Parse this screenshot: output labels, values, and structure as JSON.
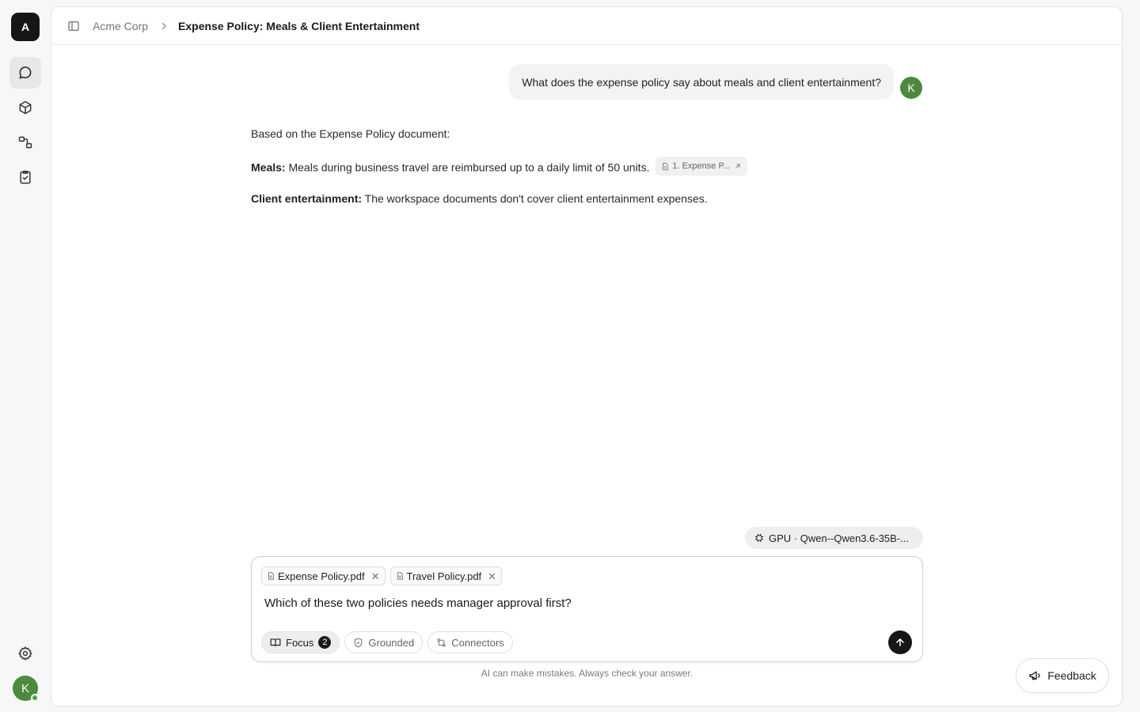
{
  "workspace": {
    "initial": "A",
    "name": "Acme Corp"
  },
  "rail": {
    "nav": [
      {
        "id": "chat",
        "icon": "chat-bubble-icon",
        "active": true
      },
      {
        "id": "knowledge",
        "icon": "cube-icon",
        "active": false
      },
      {
        "id": "workflows",
        "icon": "workflow-icon",
        "active": false
      },
      {
        "id": "tasks",
        "icon": "clipboard-check-icon",
        "active": false
      }
    ],
    "settings_icon": "gear-icon",
    "user_initial": "K"
  },
  "breadcrumb": {
    "root": "Acme Corp",
    "current": "Expense Policy: Meals & Client Entertainment"
  },
  "conversation": {
    "user_message": "What does the expense policy say about meals and client entertainment?",
    "user_initial": "K",
    "answer": {
      "intro": "Based on the Expense Policy document:",
      "meals_label": "Meals:",
      "meals_text": " Meals during business travel are reimbursed up to a daily limit of 50 units.",
      "citation": "1. Expense P...",
      "client_label": "Client entertainment:",
      "client_text": " The workspace documents don't cover client entertainment expenses."
    }
  },
  "model": {
    "label": "GPU · Qwen--Qwen3.6-35B-..."
  },
  "composer": {
    "attachments": [
      {
        "name": "Expense Policy.pdf"
      },
      {
        "name": "Travel Policy.pdf"
      }
    ],
    "text": "Which of these two policies needs manager approval first?",
    "tools": {
      "focus": {
        "label": "Focus",
        "count": "2"
      },
      "grounded": {
        "label": "Grounded"
      },
      "connectors": {
        "label": "Connectors"
      }
    }
  },
  "disclaimer": "AI can make mistakes. Always check your answer.",
  "feedback": {
    "label": "Feedback"
  },
  "colors": {
    "accent": "#161616",
    "avatar": "#4c8a3e",
    "bubble": "#f3f3f3"
  }
}
